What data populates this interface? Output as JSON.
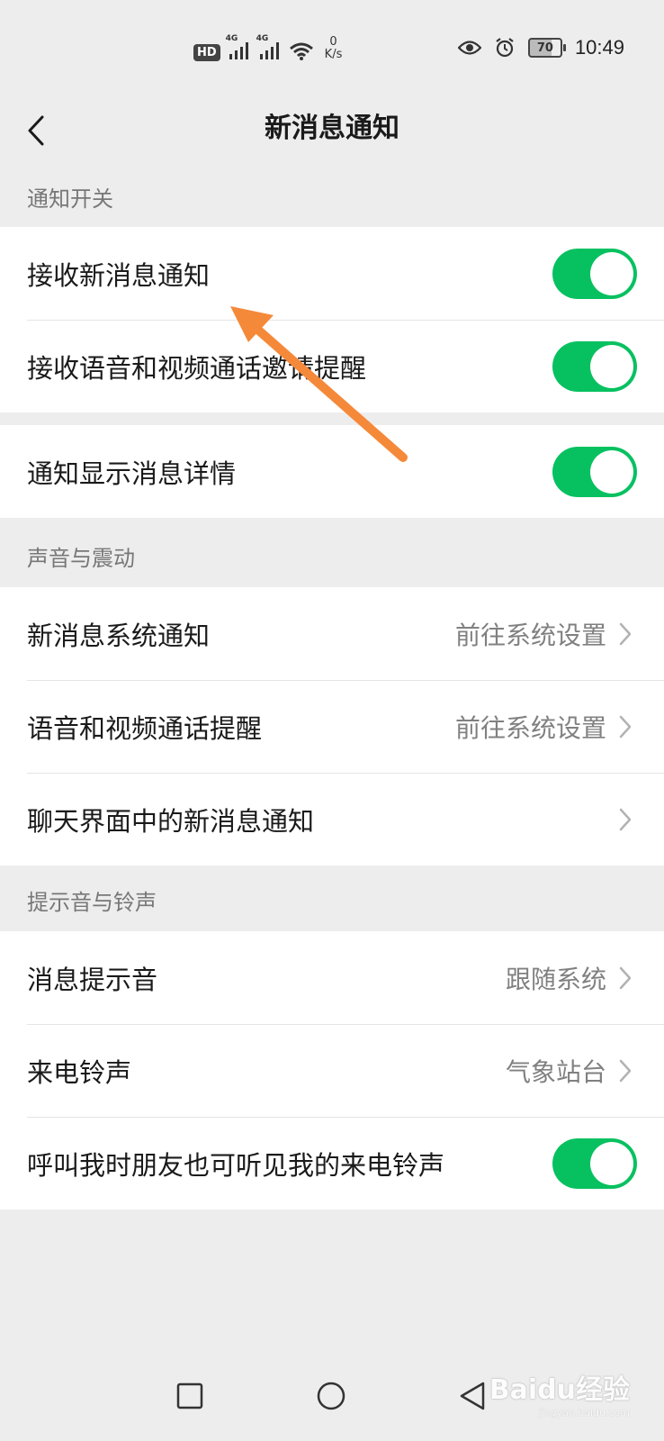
{
  "status_bar": {
    "hd": "HD",
    "net1": "4G",
    "net2": "4G",
    "speed_value": "0",
    "speed_unit": "K/s",
    "battery": "70",
    "time": "10:49"
  },
  "nav": {
    "title": "新消息通知"
  },
  "sections": {
    "notify_switch": {
      "header": "通知开关",
      "receive_new": "接收新消息通知",
      "receive_call": "接收语音和视频通话邀请提醒",
      "show_detail": "通知显示消息详情"
    },
    "sound_vibration": {
      "header": "声音与震动",
      "sys_notify": "新消息系统通知",
      "sys_notify_value": "前往系统设置",
      "call_remind": "语音和视频通话提醒",
      "call_remind_value": "前往系统设置",
      "chat_notify": "聊天界面中的新消息通知"
    },
    "tone_ring": {
      "header": "提示音与铃声",
      "msg_tone": "消息提示音",
      "msg_tone_value": "跟随系统",
      "ringtone": "来电铃声",
      "ringtone_value": "气象站台",
      "friends_hear": "呼叫我时朋友也可听见我的来电铃声"
    }
  },
  "toggles": {
    "receive_new": true,
    "receive_call": true,
    "show_detail": true,
    "friends_hear": true
  },
  "watermark": {
    "main": "Baidu经验",
    "sub": "jingyan.baidu.com"
  },
  "colors": {
    "toggle_on": "#07c160",
    "background": "#ededed",
    "annotation": "#f5893a"
  }
}
